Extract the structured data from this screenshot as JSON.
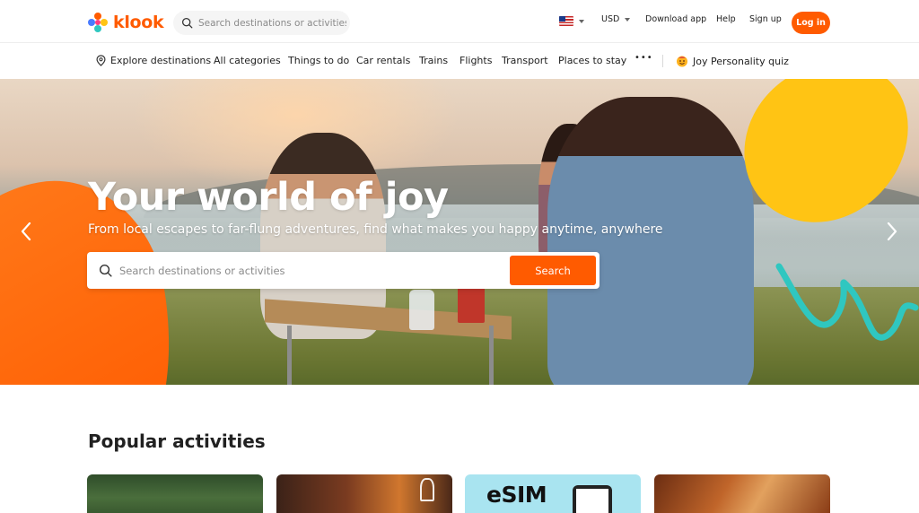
{
  "header": {
    "logo_text": "klook",
    "search_placeholder": "Search destinations or activities",
    "currency": "USD",
    "download_app": "Download app",
    "help": "Help",
    "sign_up": "Sign up",
    "log_in": "Log in"
  },
  "nav": {
    "explore": "Explore destinations",
    "items": [
      "All categories",
      "Things to do",
      "Car rentals",
      "Trains",
      "Flights",
      "Transport",
      "Places to stay"
    ],
    "more": "•••",
    "quiz": "Joy Personality quiz"
  },
  "hero": {
    "title": "Your world of joy",
    "subtitle": "From local escapes to far-flung adventures, find what makes you happy anytime, anywhere",
    "search_placeholder": "Search destinations or activities",
    "search_button": "Search"
  },
  "popular": {
    "title": "Popular activities",
    "cards": [
      {
        "label": ""
      },
      {
        "label": ""
      },
      {
        "label": "eSIM"
      },
      {
        "label": ""
      }
    ]
  },
  "colors": {
    "brand": "#ff5b00",
    "accent_yellow": "#ffc414",
    "accent_teal": "#2fc7c0"
  },
  "icons": {
    "search": "search-icon",
    "location": "location-pin-icon",
    "flag": "us-flag-icon",
    "quiz": "smiley-icon",
    "prev": "chevron-left-icon",
    "next": "chevron-right-icon"
  }
}
